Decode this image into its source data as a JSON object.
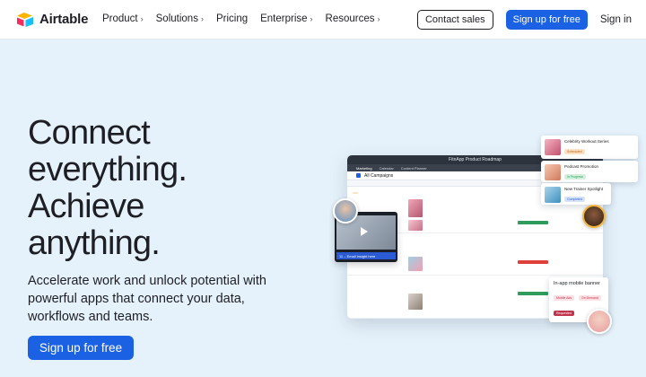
{
  "brand": {
    "name": "Airtable",
    "logo_icon": "airtable-logo-icon"
  },
  "nav": {
    "items": [
      {
        "label": "Product",
        "chevron": true
      },
      {
        "label": "Solutions",
        "chevron": true
      },
      {
        "label": "Pricing",
        "chevron": false
      },
      {
        "label": "Enterprise",
        "chevron": true
      },
      {
        "label": "Resources",
        "chevron": true
      }
    ],
    "contact_sales": "Contact sales",
    "signup": "Sign up for free",
    "signin": "Sign in"
  },
  "hero": {
    "title_lines": [
      "Connect",
      "everything.",
      "Achieve",
      "anything."
    ],
    "subtitle": "Accelerate work and unlock potential with powerful apps that connect your data, workflows and teams.",
    "cta": "Sign up for free"
  },
  "mockup": {
    "app_title": "FitnApp Product Roadmap",
    "tabs": [
      "Marketing",
      "Calendar",
      "Content Planner"
    ],
    "view_label": "All Campaigns",
    "video_caption": "11 – Email insight here",
    "cards": [
      {
        "title": "Celebrity Workout Series",
        "status": "Scheduled",
        "status_color": "#f4a742"
      },
      {
        "title": "Podcast Promotion",
        "status": "In Progress",
        "status_color": "#2e9d5c"
      },
      {
        "title": "New Trainer Spotlight",
        "status": "Completed",
        "status_color": "#2a5bd4"
      }
    ],
    "banner": {
      "title": "In-app mobile banner",
      "tags": [
        "Mobile Ads",
        "On Demand"
      ],
      "status": "Requested"
    }
  },
  "colors": {
    "primary": "#1b61e4",
    "hero_bg": "#e6f2fb",
    "text": "#1d1f25"
  }
}
